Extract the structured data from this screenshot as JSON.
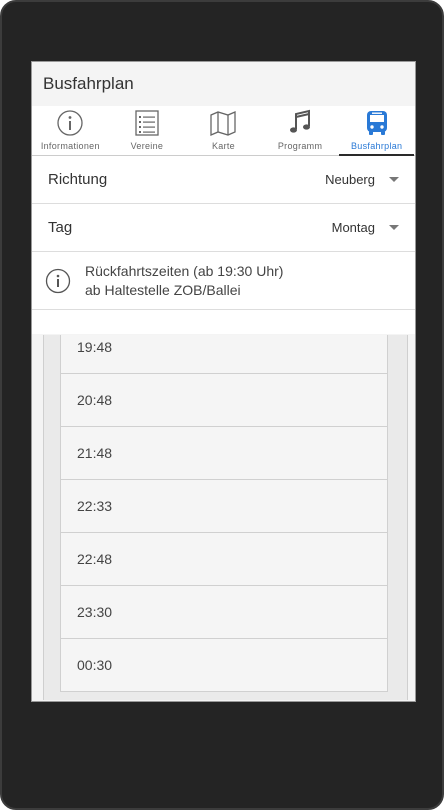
{
  "app": {
    "title": "Busfahrplan"
  },
  "tabs": [
    {
      "label": "Informationen",
      "icon": "info-icon"
    },
    {
      "label": "Vereine",
      "icon": "list-icon"
    },
    {
      "label": "Karte",
      "icon": "map-icon"
    },
    {
      "label": "Programm",
      "icon": "music-icon"
    },
    {
      "label": "Busfahrplan",
      "icon": "bus-icon",
      "active": true
    }
  ],
  "filters": {
    "richtung": {
      "label": "Richtung",
      "value": "Neuberg"
    },
    "tag": {
      "label": "Tag",
      "value": "Montag"
    }
  },
  "info": {
    "line1": "Rückfahrtszeiten (ab 19:30 Uhr)",
    "line2": "ab Haltestelle ZOB/Ballei"
  },
  "times": [
    "19:48",
    "20:48",
    "21:48",
    "22:33",
    "22:48",
    "23:30",
    "00:30"
  ],
  "colors": {
    "accent": "#2979d6",
    "device": "#242424"
  }
}
